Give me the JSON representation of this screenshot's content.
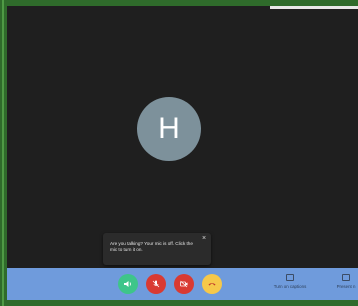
{
  "participant": {
    "initial": "H"
  },
  "tooltip": {
    "message": "Are you talking? Your mic is off. Click the mic to turn it on.",
    "close_glyph": "×"
  },
  "controls": {
    "audio_icon": "speaker-icon",
    "mic_icon": "mic-off-icon",
    "camera_icon": "camera-off-icon",
    "leave_icon": "hang-up-icon"
  },
  "side_actions": {
    "captions_label": "Turn on captions",
    "present_label": "Present n"
  },
  "colors": {
    "desktop_border": "#2f6b2b",
    "video_background": "#1f1f1f",
    "control_bar": "#6f9bdc",
    "avatar": "#7d919b",
    "audio_button": "#3ec58a",
    "mic_button": "#d93a32",
    "camera_button": "#d93a32",
    "leave_button": "#f6c84a"
  }
}
